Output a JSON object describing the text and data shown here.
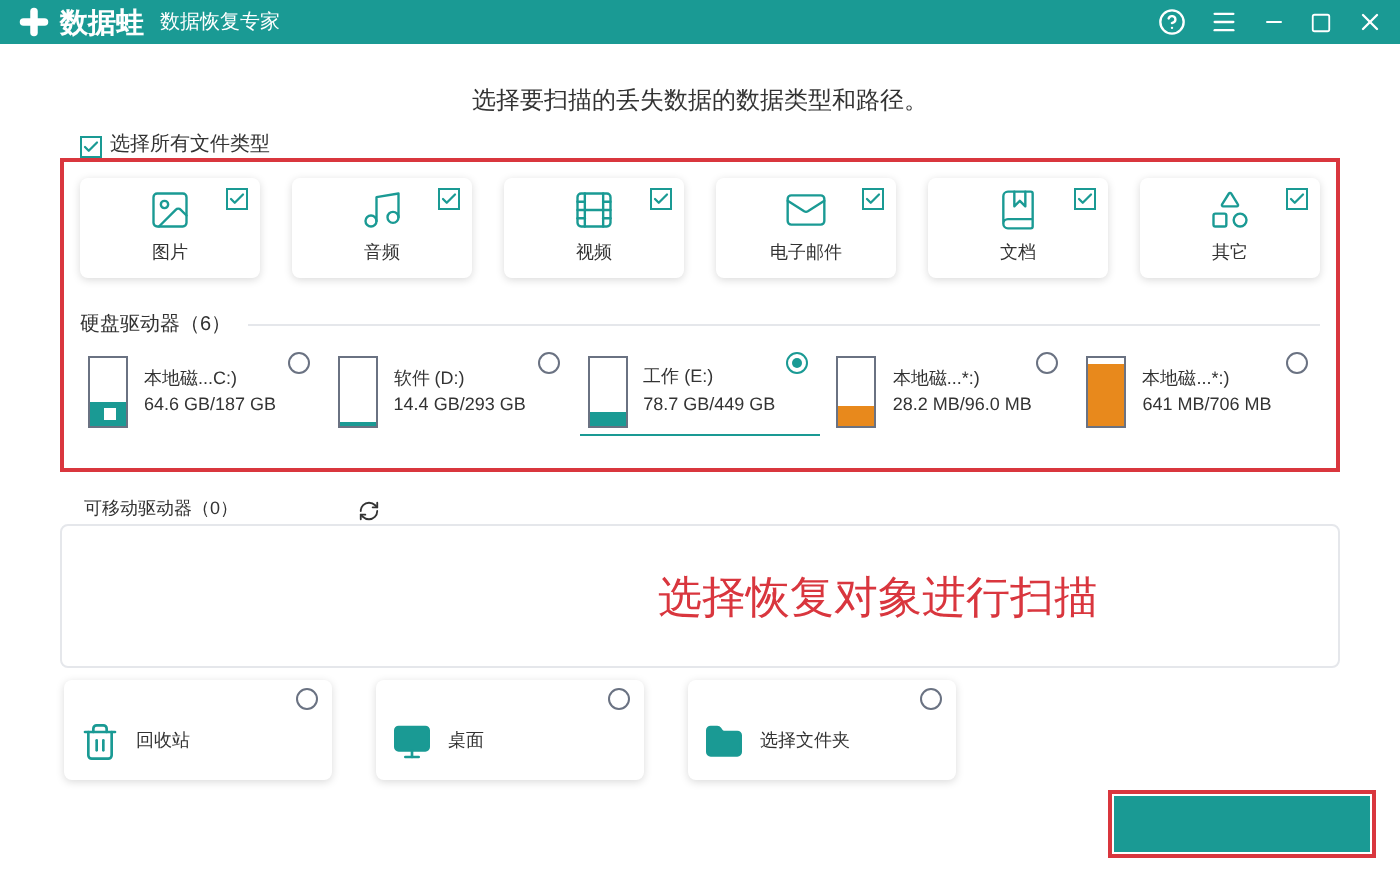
{
  "app": {
    "logo": "数据蛙",
    "title": "数据恢复专家"
  },
  "heading": "选择要扫描的丢失数据的数据类型和路径。",
  "select_all": {
    "label": "选择所有文件类型",
    "checked": true
  },
  "file_types": [
    {
      "kind": "image",
      "label": "图片",
      "checked": true
    },
    {
      "kind": "audio",
      "label": "音频",
      "checked": true
    },
    {
      "kind": "video",
      "label": "视频",
      "checked": true
    },
    {
      "kind": "email",
      "label": "电子邮件",
      "checked": true
    },
    {
      "kind": "document",
      "label": "文档",
      "checked": true
    },
    {
      "kind": "other",
      "label": "其它",
      "checked": true
    }
  ],
  "hard_drives": {
    "title": "硬盘驱动器（6）",
    "items": [
      {
        "name": "本地磁...C:)",
        "usage": "64.6 GB/187 GB",
        "level": 0.35,
        "color": "#1a9a94",
        "system": true,
        "selected": false
      },
      {
        "name": "软件 (D:)",
        "usage": "14.4 GB/293 GB",
        "level": 0.05,
        "color": "#1a9a94",
        "system": false,
        "selected": false
      },
      {
        "name": "工作 (E:)",
        "usage": "78.7 GB/449 GB",
        "level": 0.2,
        "color": "#1a9a94",
        "system": false,
        "selected": true
      },
      {
        "name": "本地磁...*:)",
        "usage": "28.2 MB/96.0 MB",
        "level": 0.3,
        "color": "#e8891c",
        "system": false,
        "selected": false
      },
      {
        "name": "本地磁...*:)",
        "usage": "641 MB/706 MB",
        "level": 0.9,
        "color": "#e8891c",
        "system": false,
        "selected": false
      }
    ]
  },
  "removable_drives": {
    "title": "可移动驱动器（0）"
  },
  "locations": [
    {
      "kind": "trash",
      "label": "回收站",
      "selected": false
    },
    {
      "kind": "desktop",
      "label": "桌面",
      "selected": false
    },
    {
      "kind": "folder",
      "label": "选择文件夹",
      "selected": false
    }
  ],
  "annotation": {
    "text": "选择恢复对象进行扫描"
  }
}
